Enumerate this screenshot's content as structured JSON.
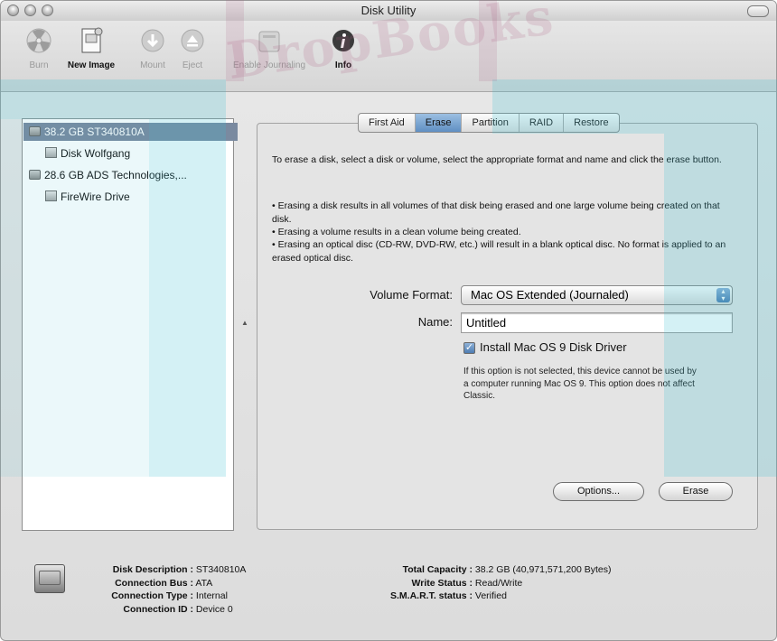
{
  "window": {
    "title": "Disk Utility"
  },
  "toolbar": {
    "burn": "Burn",
    "new_image": "New Image",
    "mount": "Mount",
    "eject": "Eject",
    "enable_journaling": "Enable Journaling",
    "info": "Info"
  },
  "sidebar": {
    "items": [
      {
        "label": "38.2 GB ST340810A",
        "kind": "disk",
        "selected": true
      },
      {
        "label": "Disk Wolfgang",
        "kind": "volume",
        "selected": false
      },
      {
        "label": "28.6 GB ADS Technologies,...",
        "kind": "disk",
        "selected": false
      },
      {
        "label": "FireWire Drive",
        "kind": "volume",
        "selected": false
      }
    ]
  },
  "tabs": [
    {
      "label": "First Aid",
      "active": false
    },
    {
      "label": "Erase",
      "active": true
    },
    {
      "label": "Partition",
      "active": false
    },
    {
      "label": "RAID",
      "active": false
    },
    {
      "label": "Restore",
      "active": false
    }
  ],
  "erase": {
    "intro": "To erase a disk, select a disk or volume, select the appropriate format and name and click the erase button.",
    "bullet1": "• Erasing a disk results in all volumes of that disk being erased and one large volume being created on that disk.",
    "bullet2": "• Erasing a volume results in a clean volume being created.",
    "bullet3": "• Erasing an optical disc (CD-RW, DVD-RW, etc.) will result in a blank optical disc. No format is applied to an erased optical disc.",
    "volume_format_label": "Volume Format:",
    "volume_format_value": "Mac OS Extended (Journaled)",
    "name_label": "Name:",
    "name_value": "Untitled",
    "checkbox_label": "Install Mac OS 9 Disk Driver",
    "checkbox_checked": true,
    "note": "If this option is not selected, this device cannot be used by a computer running Mac OS 9.  This option does not affect Classic.",
    "options_button": "Options...",
    "erase_button": "Erase"
  },
  "info": {
    "disk_description_label": "Disk Description :",
    "disk_description_value": "ST340810A",
    "connection_bus_label": "Connection Bus :",
    "connection_bus_value": "ATA",
    "connection_type_label": "Connection Type :",
    "connection_type_value": "Internal",
    "connection_id_label": "Connection ID :",
    "connection_id_value": "Device 0",
    "total_capacity_label": "Total Capacity :",
    "total_capacity_value": "38.2 GB (40,971,571,200 Bytes)",
    "write_status_label": "Write Status :",
    "write_status_value": "Read/Write",
    "smart_status_label": "S.M.A.R.T. status :",
    "smart_status_value": "Verified"
  },
  "watermark": {
    "text": "DropBooks"
  },
  "colors": {
    "selection": "#7a8aa0",
    "accent": "#5f8fc3",
    "watermark": "#3cbed2"
  }
}
